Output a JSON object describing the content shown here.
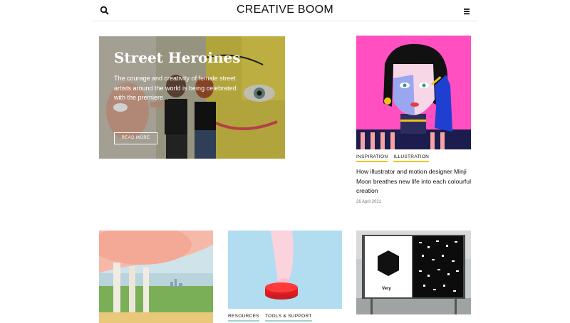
{
  "header": {
    "logo": "CREATIVE BOOM",
    "search_icon": "search-icon",
    "menu_icon": "hamburger-menu-icon"
  },
  "hero": {
    "title": "Street Heroines",
    "excerpt": "The courage and creativity of female street artists around the world is being celebrated with the premiere...",
    "button_label": "READ MORE"
  },
  "feature_card": {
    "tags": [
      "INSPIRATION",
      "ILLUSTRATION"
    ],
    "title": "How illustrator and motion designer Minji Moon breathes new life into each colourful creation",
    "date": "26 April 2021"
  },
  "cards": [
    {
      "tags": []
    },
    {
      "tags": [
        "RESOURCES",
        "TOOLS & SUPPORT"
      ]
    },
    {
      "tags": [],
      "poster_text": "Very"
    }
  ],
  "colors": {
    "tag_underline_yellow": "#f2c21b",
    "tag_underline_teal": "#9dd4cf",
    "pink_bg": "#ff4fc0"
  }
}
